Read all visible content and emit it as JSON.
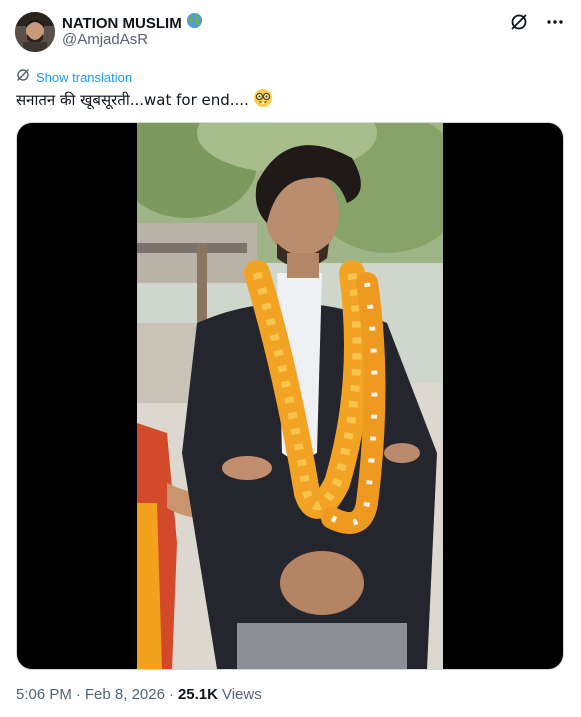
{
  "author": {
    "display_name": "NATION MUSLIM",
    "handle": "@AmjadAsR",
    "badge_icon": "globe-icon",
    "avatar_icon": "avatar"
  },
  "actions": {
    "grok_icon": "grok-icon",
    "more_icon": "more-icon"
  },
  "translation": {
    "label": "Show translation",
    "icon": "translate-icon"
  },
  "tweet": {
    "text": "सनातन की खूबसूरती...wat for end....",
    "emoji": "nerd-face-emoji"
  },
  "media": {
    "type": "video",
    "icon": "video-frame"
  },
  "meta": {
    "time": "5:06 PM",
    "separator": "·",
    "date": "Feb 8, 2026",
    "views_count": "25.1K",
    "views_label": "Views"
  },
  "colors": {
    "link": "#1d9bf0",
    "secondary_text": "#536471",
    "primary_text": "#0f1419",
    "border": "#cfd9de"
  }
}
